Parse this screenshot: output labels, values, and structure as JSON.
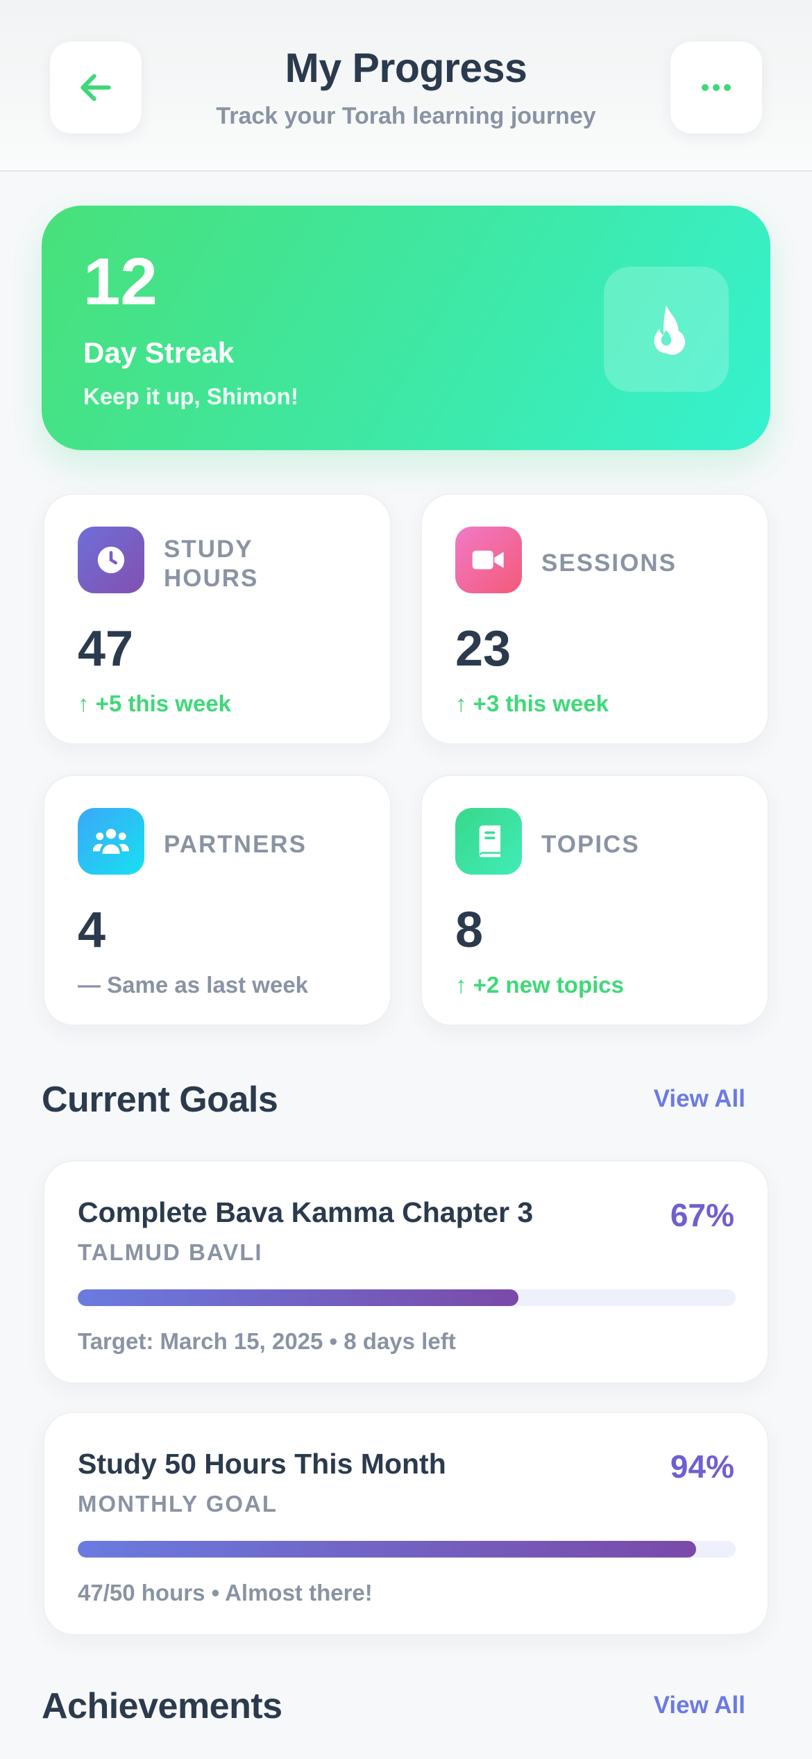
{
  "header": {
    "title": "My Progress",
    "subtitle": "Track your Torah learning journey",
    "back_icon": "arrow-left-icon",
    "more_icon": "more-dots-icon"
  },
  "streak": {
    "days": "12",
    "label": "Day Streak",
    "message": "Keep it up, Shimon!",
    "icon": "flame-icon"
  },
  "stats": [
    {
      "label": "STUDY HOURS",
      "value": "47",
      "change": "↑ +5 this week",
      "trend": "up",
      "icon": "clock-icon",
      "color": "#7a62d0"
    },
    {
      "label": "SESSIONS",
      "value": "23",
      "change": "↑ +3 this week",
      "trend": "up",
      "icon": "video-camera-icon",
      "color": "#f06a9a"
    },
    {
      "label": "PARTNERS",
      "value": "4",
      "change": "— Same as last week",
      "trend": "flat",
      "icon": "group-icon",
      "color": "#2bb8f5"
    },
    {
      "label": "TOPICS",
      "value": "8",
      "change": "↑ +2 new topics",
      "trend": "up",
      "icon": "book-icon",
      "color": "#3fe0a0"
    }
  ],
  "goals_section": {
    "title": "Current Goals",
    "view_all": "View All"
  },
  "goals": [
    {
      "title": "Complete Bava Kamma Chapter 3",
      "percent_label": "67%",
      "progress": 0.67,
      "category": "TALMUD BAVLI",
      "meta": "Target: March 15, 2025 • 8 days left"
    },
    {
      "title": "Study 50 Hours This Month",
      "percent_label": "94%",
      "progress": 0.94,
      "category": "MONTHLY GOAL",
      "meta": "47/50 hours • Almost there!"
    }
  ],
  "achievements_section": {
    "title": "Achievements",
    "view_all": "View All"
  },
  "colors": {
    "accent_green": "#3fd878",
    "accent_purple": "#6f5fcf",
    "link_blue": "#6b7be0",
    "text_dark": "#2b3a4d",
    "text_muted": "#8a93a3"
  }
}
